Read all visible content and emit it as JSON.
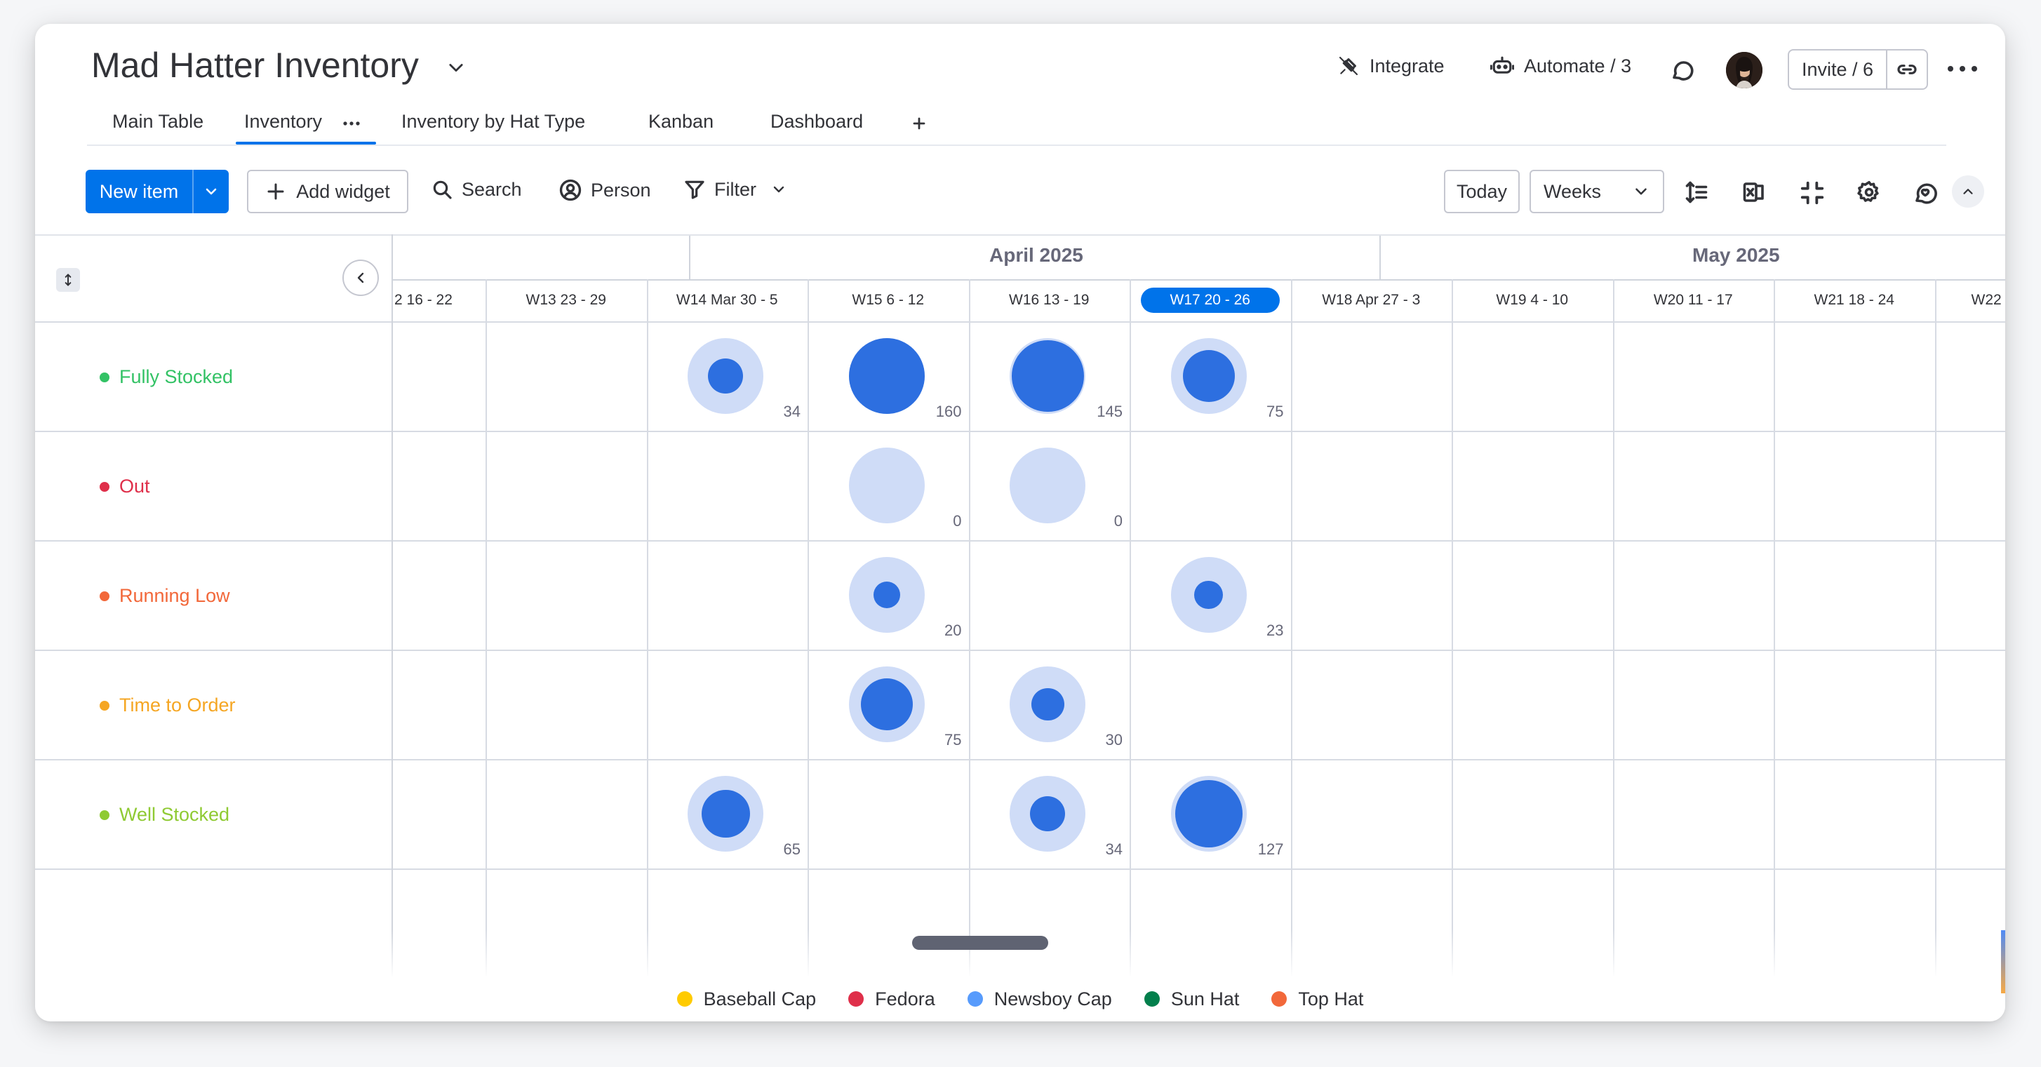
{
  "board": {
    "title": "Mad Hatter Inventory"
  },
  "header": {
    "integrate_label": "Integrate",
    "automate_label": "Automate / 3",
    "invite_label": "Invite / 6"
  },
  "tabs": [
    {
      "label": "Main Table"
    },
    {
      "label": "Inventory",
      "active": true
    },
    {
      "label": "Inventory by Hat Type"
    },
    {
      "label": "Kanban"
    },
    {
      "label": "Dashboard"
    }
  ],
  "toolbar": {
    "new_item_label": "New item",
    "add_widget_label": "Add widget",
    "search_label": "Search",
    "person_label": "Person",
    "filter_label": "Filter",
    "today_label": "Today",
    "weeks_label": "Weeks"
  },
  "timeline": {
    "months": [
      {
        "label": "April 2025"
      },
      {
        "label": "May 2025"
      }
    ],
    "weeks": [
      "2 16 - 22",
      "W13 23 - 29",
      "W14 Mar 30 - 5",
      "W15 6 - 12",
      "W16 13 - 19",
      "W17 20 - 26",
      "W18 Apr 27 - 3",
      "W19 4 - 10",
      "W20 11 - 17",
      "W21 18 - 24",
      "W22"
    ],
    "current_week_index": 5,
    "rows": [
      {
        "label": "Fully Stocked",
        "color": "#33c265"
      },
      {
        "label": "Out",
        "color": "#df2f4a"
      },
      {
        "label": "Running Low",
        "color": "#f2683a"
      },
      {
        "label": "Time to Order",
        "color": "#f5a623"
      },
      {
        "label": "Well Stocked",
        "color": "#8fca33"
      }
    ]
  },
  "chart_data": {
    "type": "scatter",
    "x_categories": [
      "2 16 - 22",
      "W13 23 - 29",
      "W14 Mar 30 - 5",
      "W15 6 - 12",
      "W16 13 - 19",
      "W17 20 - 26",
      "W18 Apr 27 - 3",
      "W19 4 - 10",
      "W20 11 - 17",
      "W21 18 - 24",
      "W22"
    ],
    "y_categories": [
      "Fully Stocked",
      "Out",
      "Running Low",
      "Time to Order",
      "Well Stocked"
    ],
    "points": [
      {
        "row": 0,
        "col": 2,
        "value": 34
      },
      {
        "row": 0,
        "col": 3,
        "value": 160
      },
      {
        "row": 0,
        "col": 4,
        "value": 145
      },
      {
        "row": 0,
        "col": 5,
        "value": 75
      },
      {
        "row": 1,
        "col": 3,
        "value": 0
      },
      {
        "row": 1,
        "col": 4,
        "value": 0
      },
      {
        "row": 2,
        "col": 3,
        "value": 20
      },
      {
        "row": 2,
        "col": 5,
        "value": 23
      },
      {
        "row": 3,
        "col": 3,
        "value": 75
      },
      {
        "row": 3,
        "col": 4,
        "value": 30
      },
      {
        "row": 4,
        "col": 2,
        "value": 65
      },
      {
        "row": 4,
        "col": 4,
        "value": 34
      },
      {
        "row": 4,
        "col": 5,
        "value": 127
      }
    ],
    "max_value": 160,
    "legend": [
      {
        "label": "Baseball Cap",
        "color": "#ffcb00"
      },
      {
        "label": "Fedora",
        "color": "#df2f4a"
      },
      {
        "label": "Newsboy Cap",
        "color": "#579bfc"
      },
      {
        "label": "Sun Hat",
        "color": "#037f4c"
      },
      {
        "label": "Top Hat",
        "color": "#f2683a"
      }
    ]
  }
}
